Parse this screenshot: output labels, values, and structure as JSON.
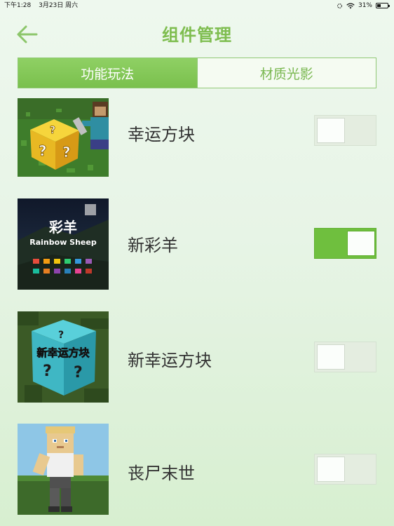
{
  "status_bar": {
    "time": "下午1:28",
    "date": "3月23日 周六",
    "battery": "31%",
    "battery_level": 0.31
  },
  "header": {
    "title": "组件管理",
    "back_icon": "arrow-left-icon",
    "accent_color": "#7ebd4f"
  },
  "tabs": [
    {
      "label": "功能玩法",
      "active": true
    },
    {
      "label": "材质光影",
      "active": false
    }
  ],
  "items": [
    {
      "name": "幸运方块",
      "enabled": false,
      "thumbnail": "lucky-block-image"
    },
    {
      "name": "新彩羊",
      "enabled": true,
      "thumbnail": "rainbow-sheep-image",
      "thumbnail_text": "彩羊",
      "thumbnail_subtext": "Rainbow Sheep"
    },
    {
      "name": "新幸运方块",
      "enabled": false,
      "thumbnail": "new-lucky-block-image",
      "thumbnail_text": "新幸运方块"
    },
    {
      "name": "丧尸末世",
      "enabled": false,
      "thumbnail": "zombie-apocalypse-image"
    }
  ]
}
